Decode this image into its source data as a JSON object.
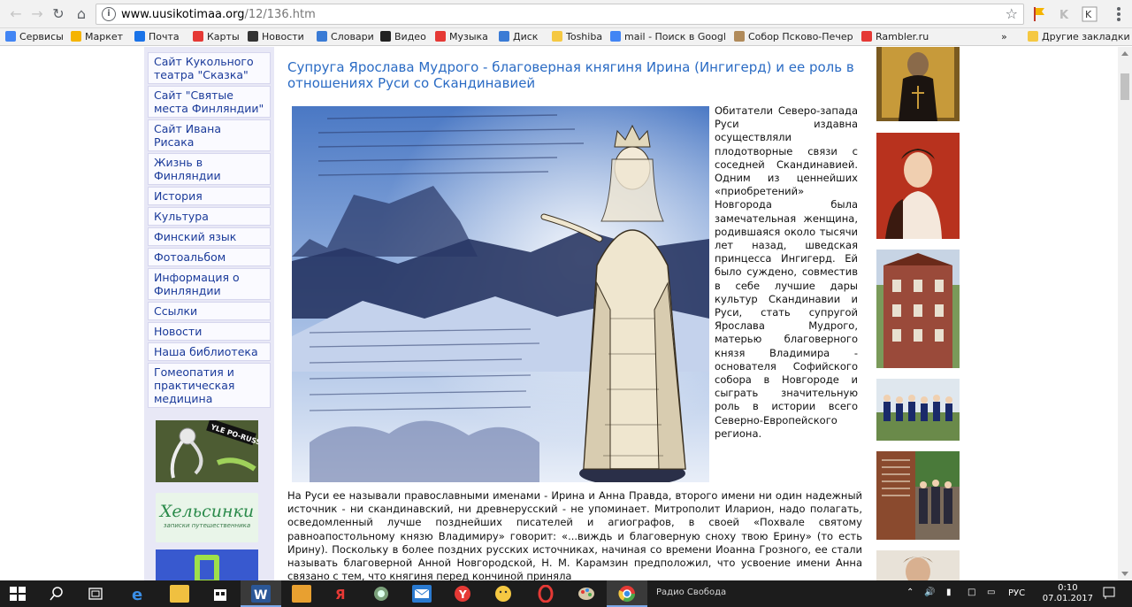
{
  "browser": {
    "url_host": "www.uusikotimaa.org",
    "url_path": "/12/136.htm",
    "bookmarks": [
      {
        "label": "Сервисы",
        "color": "#4285f4"
      },
      {
        "label": "Маркет",
        "color": "#f5b400"
      },
      {
        "label": "Почта",
        "color": "#1a73e8"
      },
      {
        "label": "Карты",
        "color": "#e53935"
      },
      {
        "label": "Новости",
        "color": "#333333"
      },
      {
        "label": "Словари",
        "color": "#3a7bd5"
      },
      {
        "label": "Видео",
        "color": "#222222"
      },
      {
        "label": "Музыка",
        "color": "#e53935"
      },
      {
        "label": "Диск",
        "color": "#3a7bd5"
      },
      {
        "label": "Toshiba",
        "color": "#f5c842"
      },
      {
        "label": "mail - Поиск в Googl",
        "color": "#4285f4"
      },
      {
        "label": "Собор Псково-Печер",
        "color": "#b08a5a"
      },
      {
        "label": "Rambler.ru",
        "color": "#e53935"
      }
    ],
    "more_bookmarks": "»",
    "other_bookmarks": "Другие закладки"
  },
  "sidebar": {
    "menu": [
      "Сайт Кукольного театра \"Сказка\"",
      "Сайт \"Святые места Финляндии\"",
      "Сайт Ивана Рисака",
      "Жизнь в Финляндии",
      "История",
      "Культура",
      "Финский язык",
      "Фотоальбом",
      "Информация о Финляндии",
      "Ссылки",
      "Новости",
      "Наша библиотека",
      "Гомеопатия и практическая медицина"
    ],
    "banner1_text": "YLE PO-RUSSKI",
    "banner2_title": "Хельсинки",
    "banner2_sub": "записки путешественника"
  },
  "article": {
    "title": "Супруга Ярослава Мудрого - благоверная княгиня Ирина (Ингигерд) и ее роль в отношениях Руси со Скандинавией",
    "side_text": "Обитатели Северо-запада Руси издавна осуществляли плодотворные связи с соседней Скандинавией. Одним из ценнейших «приобретений» Новгорода была замечательная женщина, родившаяся около тысячи лет назад, шведская принцесса Ингигерд. Ей было суждено, совместив в себе лучшие дары культур Скандинавии и Руси, стать супругой Ярослава Мудрого, матерью благоверного князя Владимира - основателя Софийского собора в Новгороде и сыграть значительную роль в истории всего Северно-Европейского региона.",
    "body_text": "На Руси ее называли православными именами - Ирина и Анна Правда, второго имени ни один надежный источник - ни скандинавский, ни древнерусский - не упоминает. Митрополит Иларион, надо полагать, осведомленный лучше позднейших писателей и агиографов, в своей «Похвале святому равноапостольному князю Владимиру» говорит: «...виждь и благоверную сноху твою Ерину» (то есть Ирину). Поскольку в более поздних русских источниках, начиная со времени Иоанна Грозного, ее стали называть благоверной Анной Новгородской, Н. М. Карамзин предположил, что усвоение имени Анна связано с тем, что княгиня перед кончиной приняла"
  },
  "taskbar": {
    "language": "РУС",
    "time": "0:10",
    "date": "07.01.2017",
    "radio_label": "Радио Свобода"
  }
}
